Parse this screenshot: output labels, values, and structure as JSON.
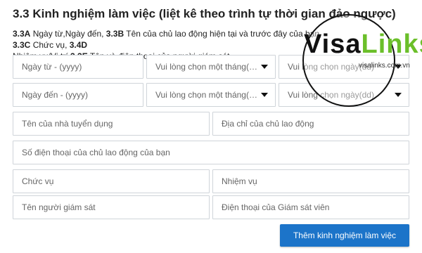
{
  "section": {
    "title": "3.3 Kinh nghiệm làm việc (liệt kê theo trình tự thời gian đảo ngược)",
    "desc": {
      "c1": "3.3A",
      "t1": " Ngày từ,Ngày đến, ",
      "c2": "3.3B",
      "t2": " Tên của chủ lao động hiện tại và trước đây của bạn, ",
      "c3": "3.3C",
      "t3": " Chức vụ, ",
      "c4": "3.4D",
      "t4": " Nhiệm vụ/Vị trí ",
      "c5": "3.3E",
      "t5": " Tên và điện thoại của người giám sát,"
    }
  },
  "form": {
    "date_from_placeholder": "Ngày từ - (yyyy)",
    "date_from_month": "Vui lòng chọn một tháng(MM)",
    "date_from_day": "Vui lòng chọn ngày(dd)",
    "date_to_placeholder": "Ngày đến - (yyyy)",
    "date_to_month": "Vui lòng chọn một tháng(MM)",
    "date_to_day": "Vui lòng chọn ngày(dd)",
    "employer_name": "Tên của nhà tuyển dụng",
    "employer_address": "Địa chỉ của chủ lao động",
    "employer_phone": "Số điện thoại của chủ lao động của bạn",
    "position": "Chức vụ",
    "duties": "Nhiệm vụ",
    "supervisor_name": "Tên người giám sát",
    "supervisor_phone": "Điện thoại của Giám sát viên",
    "add_button": "Thêm kinh nghiệm làm việc"
  },
  "watermark": {
    "brand_a": "Visa",
    "brand_b": "Links",
    "url": "visalinks.com.vn"
  },
  "colors": {
    "button": "#1c74c9",
    "border": "#cfd4d9",
    "brand_green": "#6bbf2a"
  }
}
